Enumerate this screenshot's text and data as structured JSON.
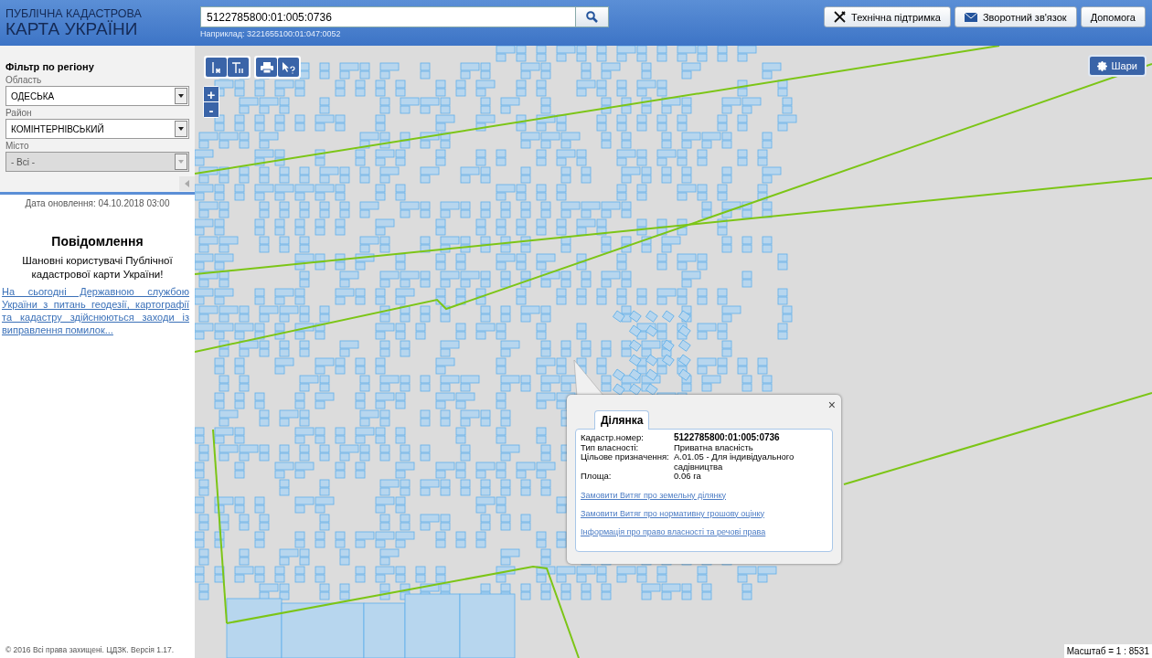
{
  "header": {
    "title_line1": "ПУБЛІЧНА КАДАСТРОВА",
    "title_line2": "КАРТА УКРАЇНИ"
  },
  "search": {
    "value": "5122785800:01:005:0736",
    "example": "Наприклад: 3221655100:01:047:0052"
  },
  "header_buttons": [
    {
      "kind": "tools",
      "label": "Технічна підтримка"
    },
    {
      "kind": "mail",
      "label": "Зворотний зв'язок"
    },
    {
      "kind": "plain",
      "label": "Допомога"
    }
  ],
  "filter": {
    "title": "Фільтр по регіону",
    "fields": [
      {
        "label": "Область",
        "value": "ОДЕСЬКА",
        "disabled": false
      },
      {
        "label": "Район",
        "value": "КОМІНТЕРНІВСЬКИЙ",
        "disabled": false
      },
      {
        "label": "Місто",
        "value": "- Всі -",
        "disabled": true
      }
    ]
  },
  "update_date": "Дата оновлення: 04.10.2018 03:00",
  "notice": {
    "title": "Повідомлення",
    "greeting": "Шановні користувачі Публічної кадастрової карти України!",
    "link": "На сьогодні Державною службою України з питань геодезії, картографії та кадастру здійснюються заходи із виправлення помилок..."
  },
  "zoom": {
    "in": "+",
    "out": "-"
  },
  "layers_button": "Шари",
  "popup": {
    "tab": "Ділянка",
    "close": "×",
    "fields": [
      {
        "label": "Кадастр.номер:",
        "value": "5122785800:01:005:0736",
        "emphasis": true
      },
      {
        "label": "Тип власності:",
        "value": "Приватна власність",
        "emphasis": false
      },
      {
        "label": "Цільове призначення:",
        "value": "A.01.05 - Для індивідуального садівництва",
        "emphasis": false
      },
      {
        "label": "Площа:",
        "value": "0.06 га",
        "emphasis": false
      }
    ],
    "links": [
      "Замовити Витяг про земельну ділянку",
      "Замовити Витяг про нормативну грошову оцінку",
      "Інформація про право власності та речові права"
    ]
  },
  "copyright": "© 2016 Всі права захищені. ЦДЗК. Версія 1.17.",
  "scale": "Масштаб = 1 : 8531"
}
